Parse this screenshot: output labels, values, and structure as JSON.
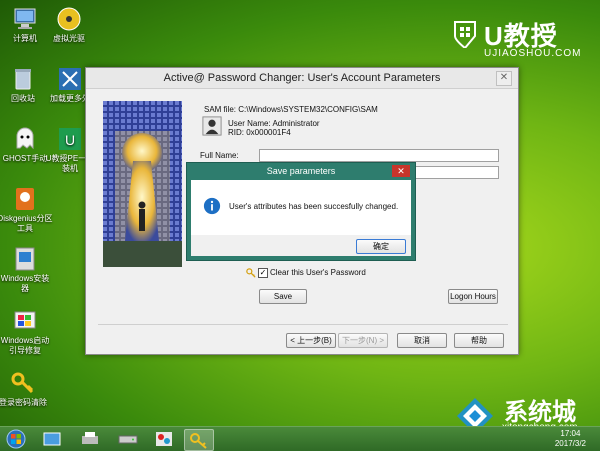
{
  "desktop": {
    "icons": [
      {
        "label": "计算机"
      },
      {
        "label": "虚拟光驱"
      },
      {
        "label": "回收站"
      },
      {
        "label": "加载更多外"
      },
      {
        "label": "GHOST手动"
      },
      {
        "label": "U教授PE一键装机"
      },
      {
        "label": "Diskgenius分区工具"
      },
      {
        "label": "Windows安装器"
      },
      {
        "label": "Windows启动引导修复"
      },
      {
        "label": "登录密码清除"
      }
    ]
  },
  "brand": {
    "name": "U教授",
    "domain": "UJIAOSHOU.COM"
  },
  "window": {
    "title": "Active@ Password Changer: User's Account Parameters",
    "sam_file": "SAM file: C:\\Windows\\SYSTEM32\\CONFIG\\SAM",
    "user_name": "User Name: Administrator",
    "rid": "RID: 0x000001F4",
    "full_name_label": "Full Name:",
    "clear_password_label": "Clear this User's Password",
    "clear_password_checked": true,
    "save_button": "Save",
    "logon_hours_button": "Logon Hours",
    "back_button": "< 上一步(B)",
    "next_button": "下一步(N) >",
    "cancel_button": "取消",
    "help_button": "帮助"
  },
  "dialog": {
    "title": "Save parameters",
    "message": "User's attributes has been succesfully changed.",
    "ok_button": "确定"
  },
  "taskbar": {
    "time": "17:04",
    "date": "2017/3/2"
  },
  "watermark": {
    "title": "系统城",
    "subtitle": "xitongcheng.com"
  },
  "colors": {
    "dialog_frame": "#2e7d6e",
    "desktop_green": "#6fb514",
    "close_red": "#c7352b"
  }
}
